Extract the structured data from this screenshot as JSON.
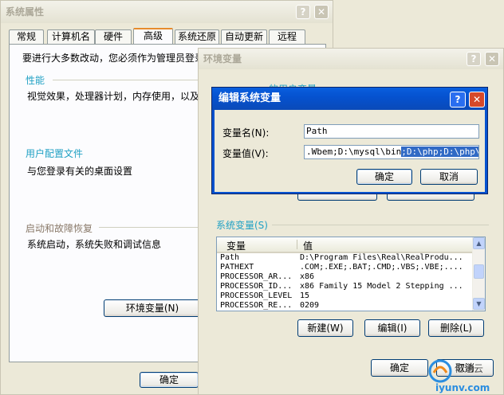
{
  "sysprops": {
    "title": "系统属性",
    "tabs": [
      "常规",
      "计算机名",
      "硬件",
      "高级",
      "系统还原",
      "自动更新",
      "远程"
    ],
    "admin_notice": "要进行大多数改动，您必须作为管理员登录",
    "perf_title": "性能",
    "perf_desc": "视觉效果，处理器计划，内存使用，以及",
    "profile_title": "用户配置文件",
    "profile_desc": "与您登录有关的桌面设置",
    "startup_title": "启动和故障恢复",
    "startup_desc": "系统启动，系统失败和调试信息",
    "env_button": "环境变量(N)",
    "ok_button": "确定"
  },
  "envvars": {
    "title": "环境变量",
    "user_vars_partial": "的用户变量",
    "system_vars_title": "系统变量(S)",
    "col_var": "变量",
    "col_val": "值",
    "rows": [
      {
        "name": "Path",
        "value": "D:\\Program Files\\Real\\RealProdu..."
      },
      {
        "name": "PATHEXT",
        "value": ".COM;.EXE;.BAT;.CMD;.VBS;.VBE;...."
      },
      {
        "name": "PROCESSOR_AR...",
        "value": "x86"
      },
      {
        "name": "PROCESSOR_ID...",
        "value": "x86 Family 15 Model 2 Stepping ..."
      },
      {
        "name": "PROCESSOR_LEVEL",
        "value": "15"
      },
      {
        "name": "PROCESSOR_RE...",
        "value": "0209"
      }
    ],
    "new_button": "新建(W)",
    "edit_button": "编辑(I)",
    "delete_button": "删除(L)",
    "ok_button": "确定",
    "cancel_button": "取消"
  },
  "editdlg": {
    "title": "编辑系统变量",
    "name_label": "变量名(N):",
    "name_value": "Path",
    "value_label": "变量值(V):",
    "value_plain": ".Wbem;D:\\mysql\\bin",
    "value_selected": ";D:\\php;D:\\php\\ext",
    "ok_button": "确定",
    "cancel_button": "取消"
  },
  "watermark": "亿速云",
  "watermark_domain": "iyunv.com",
  "colors": {
    "titlebar_active": "#0552d0",
    "group_title": "#21a1c4",
    "selection": "#316ac5",
    "tab_highlight": "#e68b2c"
  }
}
